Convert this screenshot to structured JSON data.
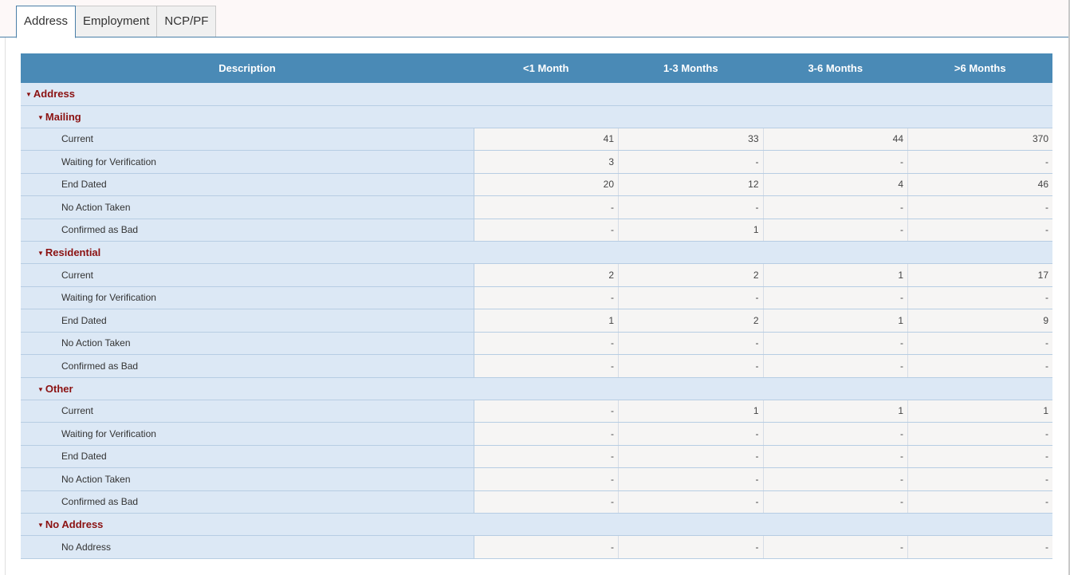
{
  "tabs": [
    {
      "label": "Address",
      "active": true
    },
    {
      "label": "Employment",
      "active": false
    },
    {
      "label": "NCP/PF",
      "active": false
    }
  ],
  "columns": [
    "Description",
    "<1 Month",
    "1-3 Months",
    "3-6 Months",
    ">6 Months"
  ],
  "group": {
    "label": "Address"
  },
  "subgroups": [
    {
      "label": "Mailing",
      "rows": [
        {
          "desc": "Current",
          "v": [
            "41",
            "33",
            "44",
            "370"
          ]
        },
        {
          "desc": "Waiting for Verification",
          "v": [
            "3",
            "-",
            "-",
            "-"
          ]
        },
        {
          "desc": "End Dated",
          "v": [
            "20",
            "12",
            "4",
            "46"
          ]
        },
        {
          "desc": "No Action Taken",
          "v": [
            "-",
            "-",
            "-",
            "-"
          ]
        },
        {
          "desc": "Confirmed as Bad",
          "v": [
            "-",
            "1",
            "-",
            "-"
          ]
        }
      ]
    },
    {
      "label": "Residential",
      "rows": [
        {
          "desc": "Current",
          "v": [
            "2",
            "2",
            "1",
            "17"
          ]
        },
        {
          "desc": "Waiting for Verification",
          "v": [
            "-",
            "-",
            "-",
            "-"
          ]
        },
        {
          "desc": "End Dated",
          "v": [
            "1",
            "2",
            "1",
            "9"
          ]
        },
        {
          "desc": "No Action Taken",
          "v": [
            "-",
            "-",
            "-",
            "-"
          ]
        },
        {
          "desc": "Confirmed as Bad",
          "v": [
            "-",
            "-",
            "-",
            "-"
          ]
        }
      ]
    },
    {
      "label": "Other",
      "rows": [
        {
          "desc": "Current",
          "v": [
            "-",
            "1",
            "1",
            "1"
          ]
        },
        {
          "desc": "Waiting for Verification",
          "v": [
            "-",
            "-",
            "-",
            "-"
          ]
        },
        {
          "desc": "End Dated",
          "v": [
            "-",
            "-",
            "-",
            "-"
          ]
        },
        {
          "desc": "No Action Taken",
          "v": [
            "-",
            "-",
            "-",
            "-"
          ]
        },
        {
          "desc": "Confirmed as Bad",
          "v": [
            "-",
            "-",
            "-",
            "-"
          ]
        }
      ]
    },
    {
      "label": "No Address",
      "rows": [
        {
          "desc": "No Address",
          "v": [
            "-",
            "-",
            "-",
            "-"
          ]
        }
      ]
    }
  ],
  "colors": {
    "header": "#4a8ab6",
    "group_text": "#8b1111",
    "row_bg": "#dce8f5"
  },
  "icons": {
    "expand": "caret-down-icon"
  }
}
